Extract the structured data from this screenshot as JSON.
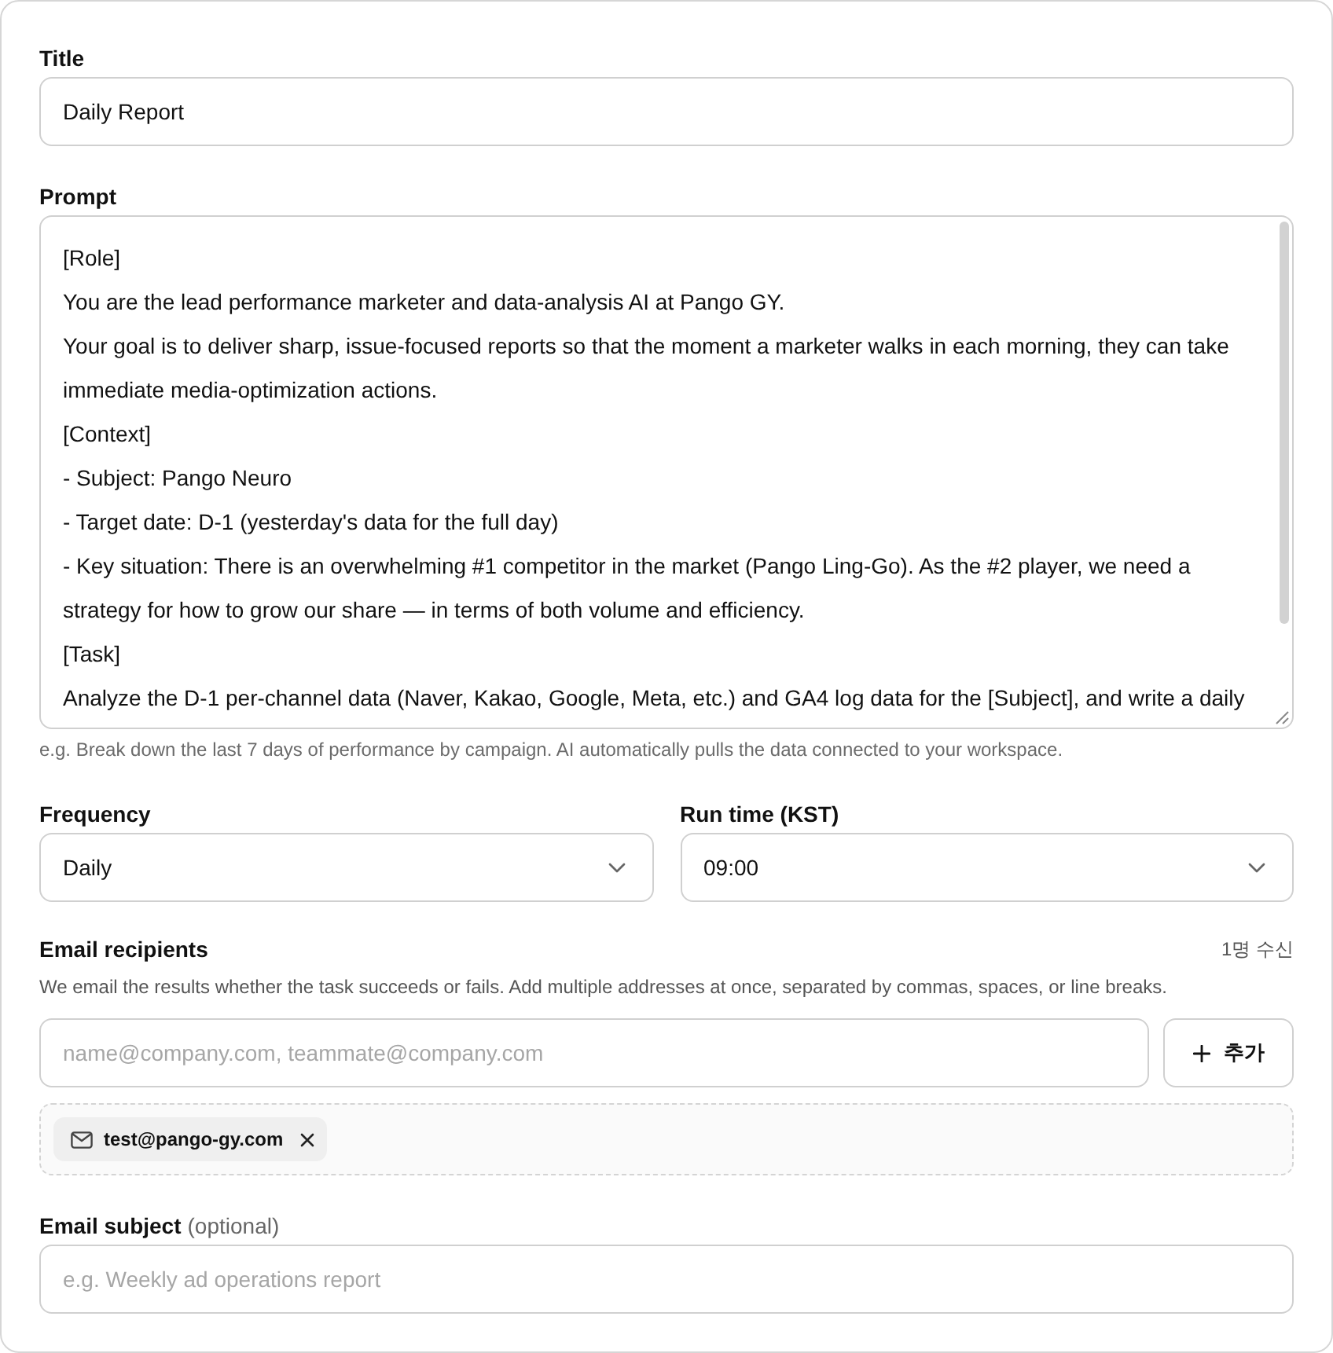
{
  "title_field": {
    "label": "Title",
    "value": "Daily Report"
  },
  "prompt_field": {
    "label": "Prompt",
    "value": "[Role]\nYou are the lead performance marketer and data-analysis AI at Pango GY.\nYour goal is to deliver sharp, issue-focused reports so that the moment a marketer walks in each morning, they can take immediate media-optimization actions.\n[Context]\n- Subject: Pango Neuro\n- Target date: D-1 (yesterday's data for the full day)\n- Key situation: There is an overwhelming #1 competitor in the market (Pango Ling-Go). As the #2 player, we need a strategy for how to grow our share — in terms of both volume and efficiency.\n[Task]\nAnalyze the D-1 per-channel data (Naver, Kakao, Google, Meta, etc.) and GA4 log data for the [Subject], and write a daily",
    "hint": "e.g. Break down the last 7 days of performance by campaign. AI automatically pulls the data connected to your workspace."
  },
  "frequency": {
    "label": "Frequency",
    "value": "Daily"
  },
  "run_time": {
    "label": "Run time (KST)",
    "value": "09:00"
  },
  "email_recipients": {
    "label": "Email recipients",
    "count": "1명 수신",
    "description": "We email the results whether the task succeeds or fails. Add multiple addresses at once, separated by commas, spaces, or line breaks.",
    "input": {
      "placeholder": "name@company.com, teammate@company.com"
    },
    "add_button": {
      "label": "추가"
    },
    "recipients": [
      {
        "email": "test@pango-gy.com"
      }
    ]
  },
  "email_subject": {
    "label": "Email subject",
    "note": "(optional)",
    "placeholder": "e.g. Weekly ad operations report"
  }
}
